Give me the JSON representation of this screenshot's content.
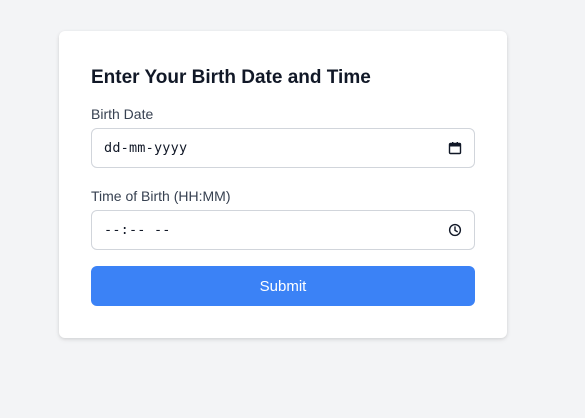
{
  "form": {
    "title": "Enter Your Birth Date and Time",
    "birth_date": {
      "label": "Birth Date",
      "value": "dd-mm-yyyy",
      "icon": "calendar-icon"
    },
    "birth_time": {
      "label": "Time of Birth (HH:MM)",
      "value": "--:-- --",
      "icon": "clock-icon"
    },
    "submit_label": "Submit"
  },
  "colors": {
    "background": "#f3f4f6",
    "card": "#ffffff",
    "accent": "#3b82f6",
    "border": "#d1d5db",
    "text": "#111827"
  }
}
